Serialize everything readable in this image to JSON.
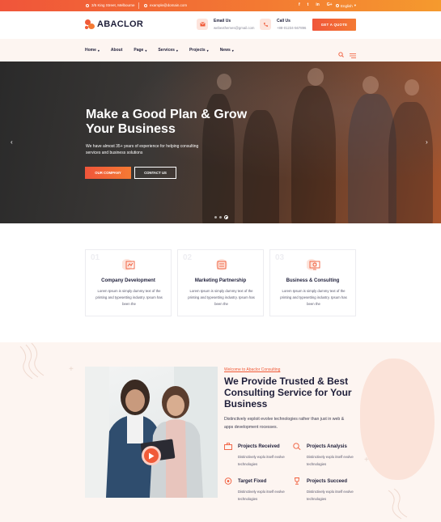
{
  "topbar": {
    "address": "3/5 King Street, Melbourne",
    "email": "example@domain.com",
    "socials": [
      "f",
      "t",
      "in",
      "G+"
    ],
    "language": "English"
  },
  "header": {
    "logo_text": "ABACLOR",
    "email_title": "Email Us",
    "email_value": "webexthemes@gmail.com",
    "call_title": "Call Us",
    "call_value": "+88-01234-567896",
    "quote_button": "GET A QUOTE"
  },
  "nav": {
    "items": [
      {
        "label": "Home"
      },
      {
        "label": "About"
      },
      {
        "label": "Page"
      },
      {
        "label": "Services"
      },
      {
        "label": "Projects"
      },
      {
        "label": "News"
      }
    ]
  },
  "hero": {
    "title": "Make a Good Plan & Grow Your Business",
    "subtitle": "We have almost 35+ years of experience for helping consulting services and business solutions",
    "primary_button": "OUR COMPANY",
    "secondary_button": "CONTACT US",
    "slides_total": 3,
    "active_slide": 3
  },
  "services": [
    {
      "num": "01",
      "title": "Company Development",
      "text": "Lorem Ipsum is simply dummy text of the printing and typesetting industry. Ipsum has been the"
    },
    {
      "num": "02",
      "title": "Marketing Partnership",
      "text": "Lorem Ipsum is simply dummy text of the printing and typesetting industry. Ipsum has been the"
    },
    {
      "num": "03",
      "title": "Business & Consulting",
      "text": "Lorem Ipsum is simply dummy text of the printing and typesetting industry. Ipsum has been the"
    }
  ],
  "about": {
    "eyebrow": "Welcome to Abaclor Consulting",
    "title": "We Provide Trusted & Best Consulting Service for Your Business",
    "text": "Distinctively exploit evolve technologies rather than just in web & apps development rocesses.",
    "features": [
      {
        "title": "Projects Received",
        "text": "Distinctively explo itself evolve technologies"
      },
      {
        "title": "Projects Analysis",
        "text": "Distinctively explo itself evolve technologies"
      },
      {
        "title": "Target Fixed",
        "text": "Distinctively explo itself evolve technologies"
      },
      {
        "title": "Projects Succeed",
        "text": "Distinctively explo itself evolve technologies"
      }
    ]
  },
  "colors": {
    "accent": "#f05a38",
    "accent_light": "#f47a33",
    "dark": "#1f1f3a",
    "cream": "#fdf5f1"
  }
}
